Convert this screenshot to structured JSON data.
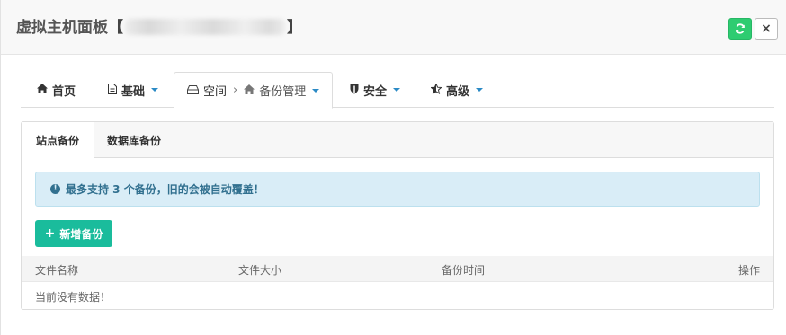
{
  "dialog": {
    "title": "虚拟主机面板",
    "title_open": "【",
    "title_close": "】",
    "refresh_icon": "refresh-icon",
    "close_label": "×"
  },
  "nav": {
    "home": "首页",
    "basic": "基础",
    "space": "空间",
    "breadcrumb_sep": "›",
    "backup_manage": "备份管理",
    "security": "安全",
    "advanced": "高级"
  },
  "panel": {
    "tabs": [
      "站点备份",
      "数据库备份"
    ],
    "alert": "最多支持 3 个备份，旧的会被自动覆盖！",
    "add_button": "新增备份",
    "columns": [
      "文件名称",
      "文件大小",
      "备份时间",
      "操作"
    ],
    "empty_text": "当前没有数据！"
  },
  "colors": {
    "refresh_bg": "#2ecc71",
    "add_bg": "#1abc9c",
    "alert_bg": "#d9edf7",
    "alert_text": "#31708f",
    "caret": "#2b8ac5"
  }
}
